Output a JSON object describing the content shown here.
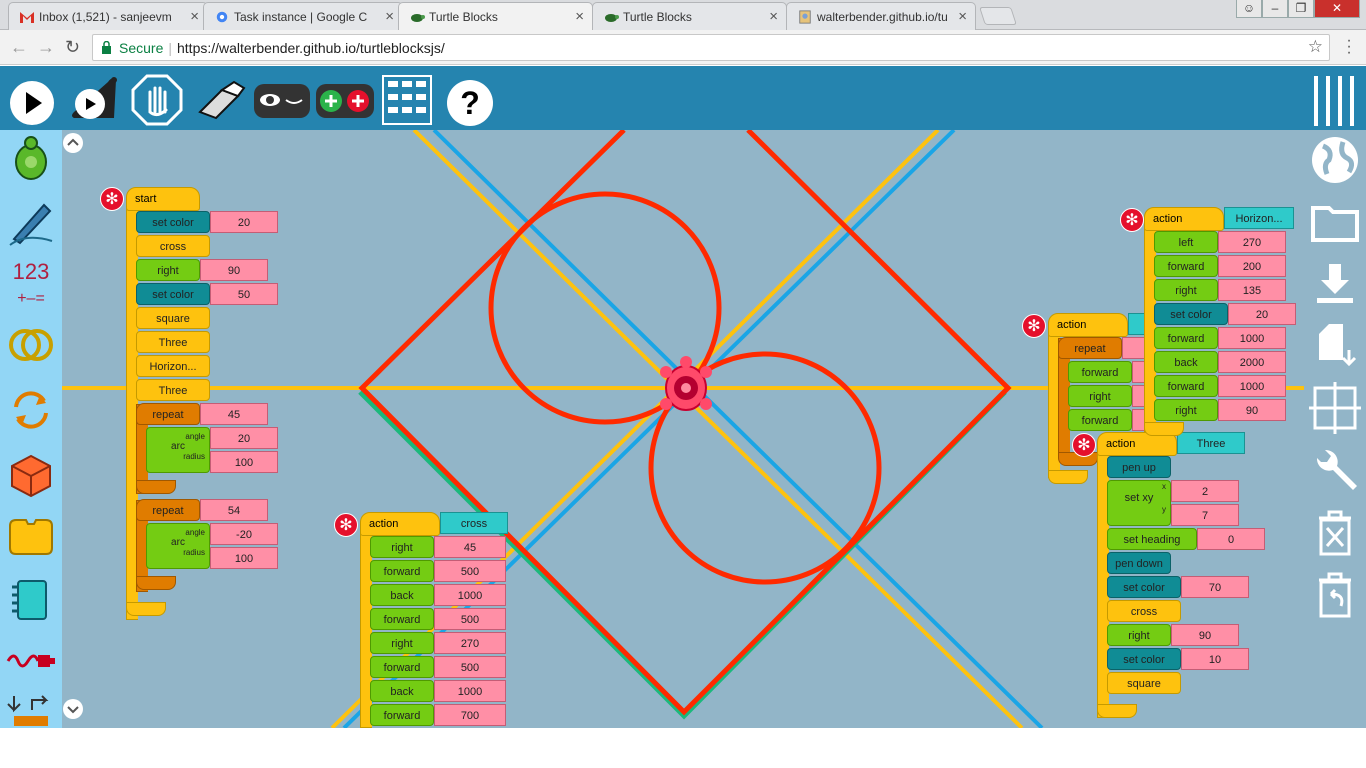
{
  "tabs": [
    {
      "label": "Inbox (1,521) - sanjeevm",
      "icon": "gmail-icon"
    },
    {
      "label": "Task instance | Google C",
      "icon": "gear-icon"
    },
    {
      "label": "Turtle Blocks",
      "icon": "turtle-icon"
    },
    {
      "label": "Turtle Blocks",
      "icon": "turtle-icon"
    },
    {
      "label": "walterbender.github.io/tu",
      "icon": "page-icon"
    }
  ],
  "address": {
    "secure": "Secure",
    "url": "https://walterbender.github.io/turtleblocksjs/"
  },
  "colors": {
    "toolbar": "#2584af",
    "canvas": "#92b5c8",
    "palette": "#92d6f5",
    "yellow_line": "#fec20e",
    "blue_line": "#1aa5e6",
    "green_line": "#1bb87c",
    "red_line": "#ff2a00"
  },
  "start_stack": {
    "hat": "start",
    "set_color_1": "set color",
    "set_color_1_val": "20",
    "cross": "cross",
    "right": "right",
    "right_val": "90",
    "set_color_2": "set color",
    "set_color_2_val": "50",
    "square": "square",
    "three": "Three",
    "horizon": "Horizon...",
    "three2": "Three",
    "repeat_1": "repeat",
    "repeat_1_val": "45",
    "arc_1": {
      "angle": "angle",
      "arc": "arc",
      "radius": "radius",
      "angle_val": "20",
      "radius_val": "100"
    },
    "repeat_2": "repeat",
    "repeat_2_val": "54",
    "arc_2": {
      "angle": "angle",
      "arc": "arc",
      "radius": "radius",
      "angle_val": "-20",
      "radius_val": "100"
    }
  },
  "cross_stack": {
    "hat": "action",
    "name": "cross",
    "rows": [
      {
        "label": "right",
        "val": "45"
      },
      {
        "label": "forward",
        "val": "500"
      },
      {
        "label": "back",
        "val": "1000"
      },
      {
        "label": "forward",
        "val": "500"
      },
      {
        "label": "right",
        "val": "270"
      },
      {
        "label": "forward",
        "val": "500"
      },
      {
        "label": "back",
        "val": "1000"
      },
      {
        "label": "forward",
        "val": "700"
      }
    ]
  },
  "horizon_stack": {
    "hat": "action",
    "name": "Horizon...",
    "rows": [
      {
        "label": "left",
        "val": "270",
        "color": "g"
      },
      {
        "label": "forward",
        "val": "200",
        "color": "g"
      },
      {
        "label": "right",
        "val": "135",
        "color": "g"
      },
      {
        "label": "set color",
        "val": "20",
        "color": "t"
      },
      {
        "label": "forward",
        "val": "1000",
        "color": "g"
      },
      {
        "label": "back",
        "val": "2000",
        "color": "g"
      },
      {
        "label": "forward",
        "val": "1000",
        "color": "g"
      },
      {
        "label": "right",
        "val": "90",
        "color": "g"
      }
    ]
  },
  "square_stack": {
    "hat": "action",
    "repeat": "repeat",
    "rows": [
      "forward",
      "right",
      "forward"
    ]
  },
  "three_stack": {
    "hat": "action",
    "name": "Three",
    "pen_up": "pen up",
    "set_xy": "set xy",
    "x": "x",
    "y": "y",
    "x_val": "2",
    "y_val": "7",
    "set_heading": "set heading",
    "heading_val": "0",
    "pen_down": "pen down",
    "set_color_1": "set color",
    "set_color_1_val": "70",
    "cross": "cross",
    "right": "right",
    "right_val": "90",
    "set_color_2": "set color",
    "set_color_2_val": "10",
    "square": "square"
  },
  "palette_123": "123"
}
